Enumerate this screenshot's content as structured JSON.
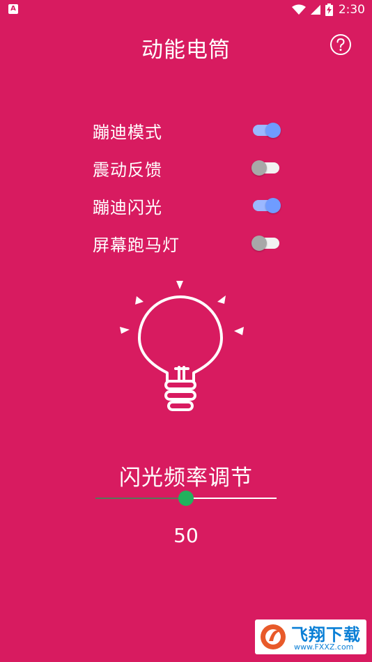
{
  "status_bar": {
    "notification_icon": "A",
    "time": "2:30",
    "icons": [
      "wifi-icon",
      "signal-icon",
      "battery-charging-icon"
    ]
  },
  "header": {
    "title": "动能电筒",
    "help_icon": "help-circle-icon"
  },
  "toggles": [
    {
      "label": "蹦迪模式",
      "on": true
    },
    {
      "label": "震动反馈",
      "on": false
    },
    {
      "label": "蹦迪闪光",
      "on": true
    },
    {
      "label": "屏幕跑马灯",
      "on": false
    }
  ],
  "bulb": {
    "icon": "light-bulb-icon"
  },
  "frequency": {
    "title": "闪光频率调节",
    "value": "50",
    "fraction": 0.5
  },
  "watermark": {
    "name": "飞翔下载",
    "url": "www.FXXZ.com"
  },
  "colors": {
    "background": "#d81b60",
    "switch_on_thumb": "#6f9cff",
    "switch_on_track": "#9bb8ff",
    "switch_off_thumb": "#a8a8a8",
    "slider_knob": "#22b15d",
    "watermark_text": "#0a7fd6"
  }
}
